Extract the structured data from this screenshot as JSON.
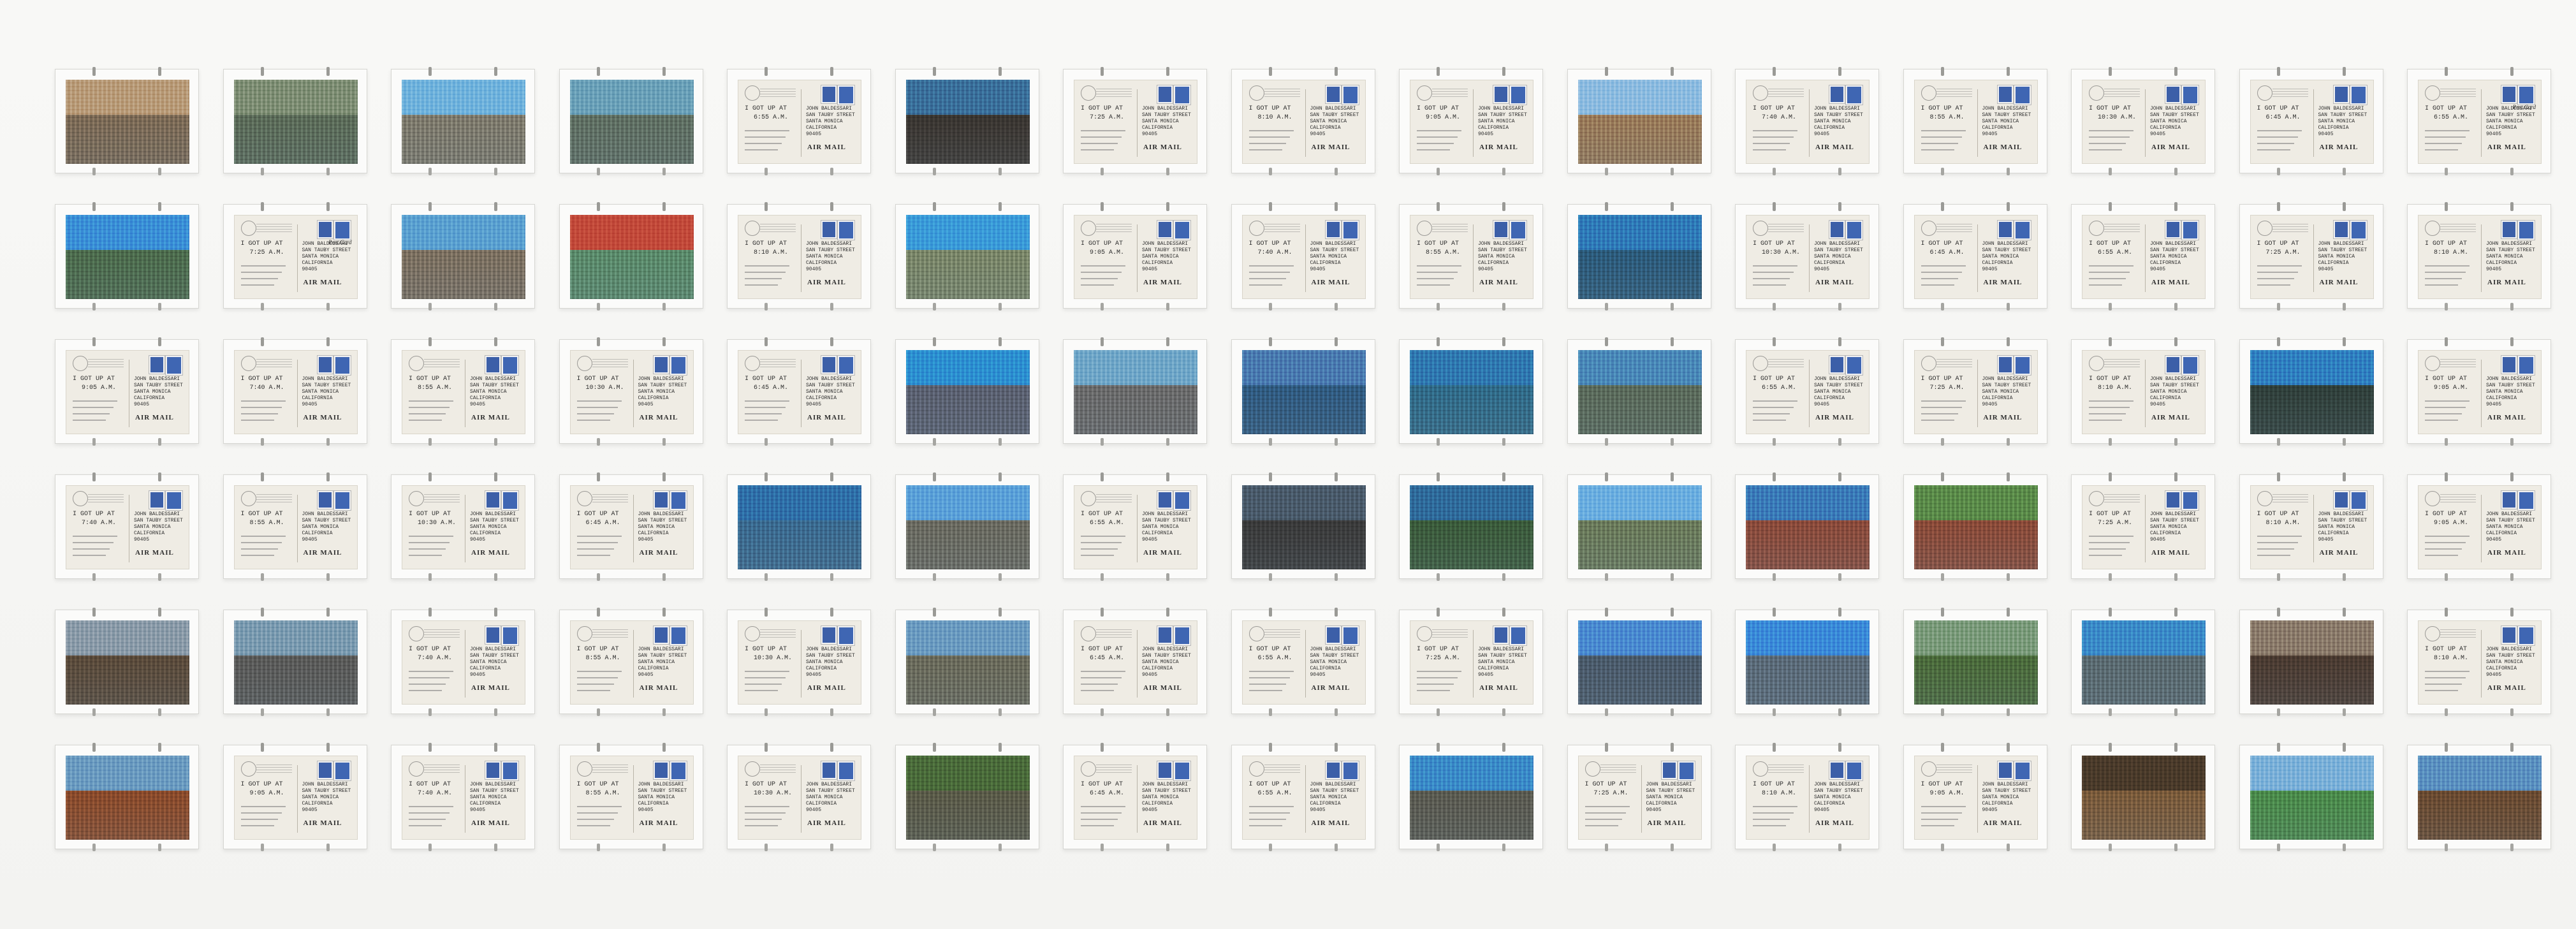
{
  "artwork": {
    "rows": 6,
    "columns": 15,
    "postcard_text": {
      "got_up_at": "I GOT UP AT",
      "times": [
        "6:55 A.M.",
        "7:25 A.M.",
        "8:10 A.M.",
        "9:05 A.M.",
        "7:40 A.M.",
        "8:55 A.M.",
        "10:30 A.M.",
        "6:45 A.M."
      ],
      "address_block": "JOHN BALDESSARI\nSAN TAUBY STREET\nSANTA MONICA\nCALIFORNIA\n90405",
      "air_mail": "AIR MAIL",
      "post_card": "Post Card"
    },
    "layout_pattern": [
      [
        "photo:city-aerial-brown",
        "photo:city-aerial-green",
        "photo:capitol-dome",
        "photo:stadium-aerial",
        "back",
        "photo:ironwork-balcony",
        "back",
        "back",
        "back",
        "photo:skyline-towers",
        "back",
        "back",
        "back",
        "back",
        "back-postcard"
      ],
      [
        "photo:skyline-blue-sky",
        "back-postcard",
        "photo:city-wide",
        "photo:cartoon-map",
        "back",
        "photo:highway-interchange",
        "back",
        "back",
        "back",
        "photo:skyline-waterfront",
        "back",
        "back",
        "back",
        "back",
        "back"
      ],
      [
        "back",
        "back",
        "back",
        "back",
        "back",
        "photo:bridge-harbor",
        "photo:downtown-towers",
        "photo:bridge-cables",
        "photo:bridge-bay",
        "photo:bridge-aerial",
        "back",
        "back",
        "back",
        "photo:statue-harbor",
        "back"
      ],
      [
        "back",
        "back",
        "back",
        "back",
        "photo:bridge-blue",
        "photo:stadium-bowl",
        "back",
        "photo:street-canyon",
        "photo:civic-building",
        "photo:arch-monument",
        "photo:brick-arch",
        "photo:brick-street",
        "back",
        "back",
        "back"
      ],
      [
        "photo:street-buildings",
        "photo:city-haze",
        "back",
        "back",
        "back",
        "photo:church-skyline",
        "back",
        "back",
        "back",
        "photo:city-horizon",
        "photo:city-clouds",
        "photo:park-aerial",
        "photo:skyline-sea",
        "photo:dense-city",
        "back"
      ],
      [
        "photo:arena-building",
        "back",
        "back",
        "back",
        "back",
        "photo:garden-tree",
        "back",
        "back",
        "photo:plaza-street",
        "back",
        "back",
        "back",
        "photo:night-fountain",
        "photo:park-trees",
        "photo:church-square"
      ]
    ],
    "palettes": {
      "city-aerial-brown": [
        "#b89a78",
        "#7c6a55"
      ],
      "city-aerial-green": [
        "#7e8e74",
        "#5b6b58"
      ],
      "capitol-dome": [
        "#6fb2dc",
        "#7e7a6c"
      ],
      "stadium-aerial": [
        "#6aa0b8",
        "#5f6f62"
      ],
      "ironwork-balcony": [
        "#3a6f9a",
        "#3a3530"
      ],
      "skyline-towers": [
        "#8cbbe0",
        "#9a7a58"
      ],
      "skyline-blue-sky": [
        "#3a8fd6",
        "#4c6b4c"
      ],
      "city-wide": [
        "#5aa0d0",
        "#7c7060"
      ],
      "cartoon-map": [
        "#c24a3a",
        "#5a8a6a"
      ],
      "highway-interchange": [
        "#3a9ad8",
        "#7a8668"
      ],
      "skyline-waterfront": [
        "#2f7ab8",
        "#2b5a7a"
      ],
      "bridge-harbor": [
        "#2c8fd0",
        "#5a6070"
      ],
      "downtown-towers": [
        "#6fa6c8",
        "#6a6a6a"
      ],
      "bridge-cables": [
        "#4a7ab0",
        "#2f5a80"
      ],
      "bridge-bay": [
        "#2f78b0",
        "#2f6a88"
      ],
      "bridge-aerial": [
        "#4a88b8",
        "#5a6a5a"
      ],
      "statue-harbor": [
        "#2f7fc0",
        "#2f3f3a"
      ],
      "bridge-blue": [
        "#2f6fa8",
        "#3a6a90"
      ],
      "stadium-bowl": [
        "#5aa0d8",
        "#6a6a60"
      ],
      "street-canyon": [
        "#4a5a6a",
        "#3a3a3a"
      ],
      "civic-building": [
        "#2f6a9a",
        "#3a5a3a"
      ],
      "arch-monument": [
        "#6aaee0",
        "#6a7a5a"
      ],
      "brick-arch": [
        "#3a7ab8",
        "#8a4a3a"
      ],
      "brick-street": [
        "#5a8a4a",
        "#8a4a38"
      ],
      "street-buildings": [
        "#8a9aa8",
        "#5a4a3a"
      ],
      "city-haze": [
        "#7a9ab0",
        "#5a5a58"
      ],
      "church-skyline": [
        "#6a9ac0",
        "#6a6a5a"
      ],
      "city-horizon": [
        "#4a8ad0",
        "#4a5a6a"
      ],
      "city-clouds": [
        "#3a8ad8",
        "#5a6a78"
      ],
      "park-aerial": [
        "#7a9a7a",
        "#4a6a3a"
      ],
      "skyline-sea": [
        "#3a8ac8",
        "#5a6a70"
      ],
      "dense-city": [
        "#8a7a6a",
        "#4a3a30"
      ],
      "arena-building": [
        "#6a9ac0",
        "#8a4a2a"
      ],
      "garden-tree": [
        "#4a6a3a",
        "#5a5a48"
      ],
      "plaza-street": [
        "#3a8ac8",
        "#5a5a50"
      ],
      "night-fountain": [
        "#4a3a2a",
        "#7a5a3a"
      ],
      "park-trees": [
        "#7ab0d8",
        "#4a8a4a"
      ],
      "church-square": [
        "#5a90c0",
        "#6a4a30"
      ]
    }
  }
}
